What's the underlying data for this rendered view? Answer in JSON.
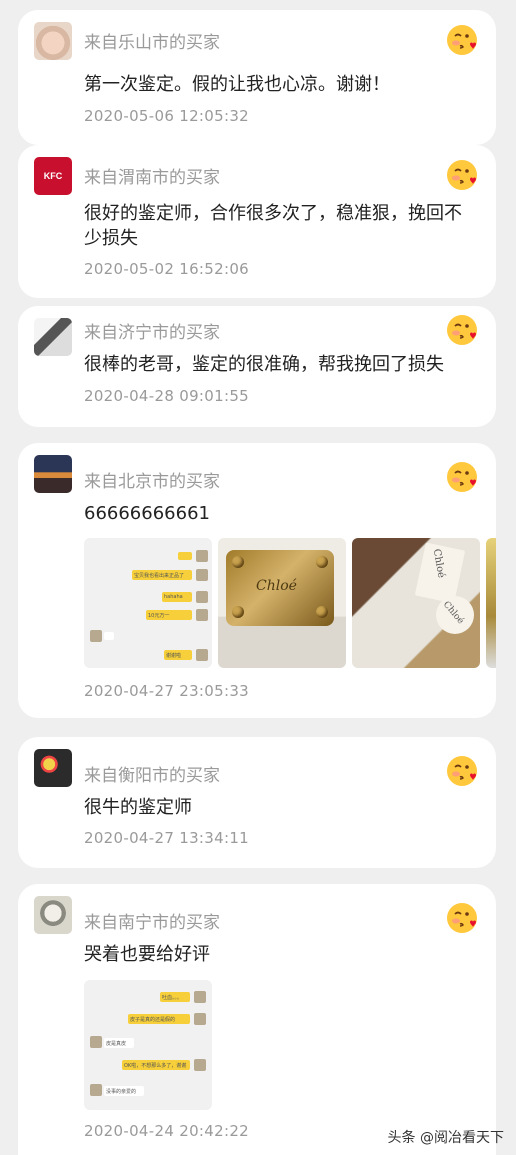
{
  "reviews": [
    {
      "buyer": "来自乐山市的买家",
      "comment": "第一次鉴定。假的让我也心凉。谢谢！",
      "time": "2020-05-06 12:05:32"
    },
    {
      "buyer": "来自渭南市的买家",
      "comment": "很好的鉴定师，合作很多次了，稳准狠，挽回不少损失",
      "time": "2020-05-02 16:52:06",
      "avatar_text": "KFC"
    },
    {
      "buyer": "来自济宁市的买家",
      "comment": "很棒的老哥，鉴定的很准确，帮我挽回了损失",
      "time": "2020-04-28 09:01:55"
    },
    {
      "buyer": "来自北京市的买家",
      "comment": "66666666661",
      "time": "2020-04-27 23:05:33",
      "chat": {
        "m1": "宝贝我也看出来正品了",
        "m2": "hahaha",
        "m3": "10元万一",
        "m4": "谢谢啦"
      },
      "logo1": "Chloé",
      "logo2": "Chloé",
      "logo3": "Chloé"
    },
    {
      "buyer": "来自衡阳市的买家",
      "comment": "很牛的鉴定师",
      "time": "2020-04-27 13:34:11"
    },
    {
      "buyer": "来自南宁市的买家",
      "comment": "哭着也要给好评",
      "time": "2020-04-24 20:42:22",
      "chat": {
        "m1": "吐血。。。",
        "m2": "皮子是真的还是假的",
        "m3": "皮是真皮",
        "m4": "OK啦，不想那么多了，谢谢",
        "m5": "没事的亲爱的"
      }
    }
  ],
  "watermark": "头条 @阅冶看天下",
  "colors": {
    "background": "#efefef",
    "card": "#ffffff",
    "muted": "#9a9a9a",
    "text": "#222222",
    "chat_yellow": "#f6cf3a"
  },
  "icons": {
    "reaction": "blushing-kiss-emoji-icon"
  }
}
